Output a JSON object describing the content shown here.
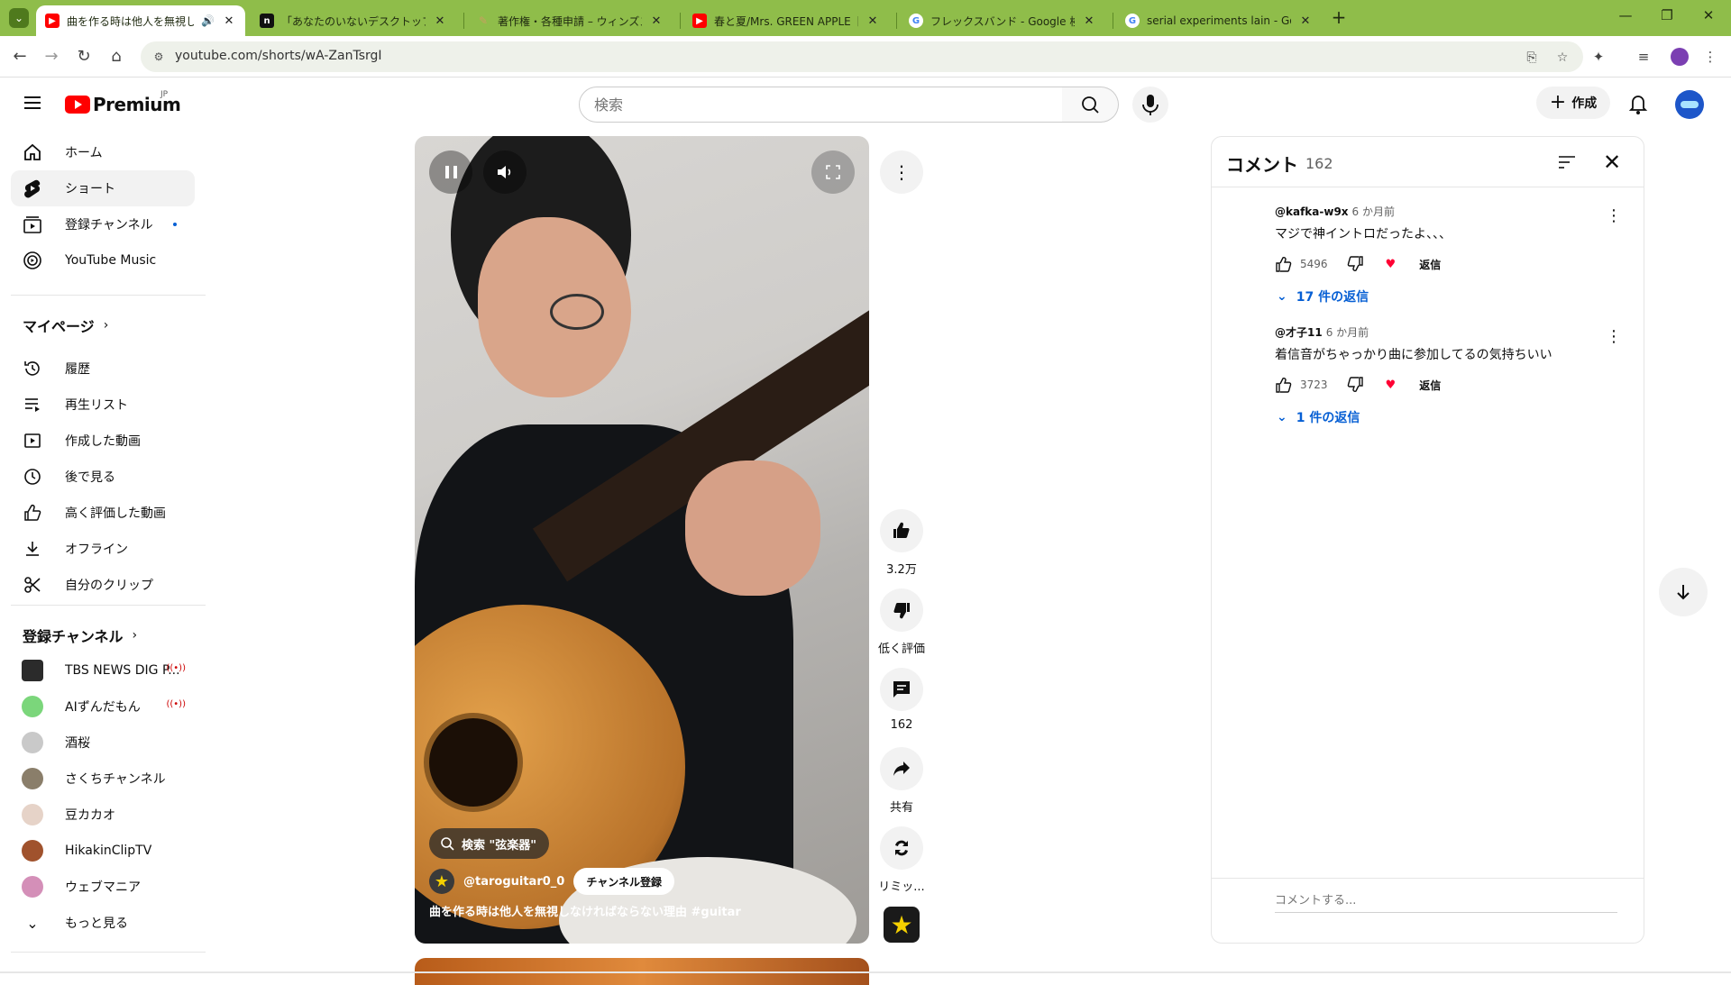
{
  "browser": {
    "tabs": [
      {
        "title": "曲を作る時は他人を無視しな",
        "favicon": "youtube-icon",
        "active": true,
        "audible": true
      },
      {
        "title": "「あなたのいないデスクトップ」につい",
        "favicon": "notion-icon",
        "active": false
      },
      {
        "title": "著作権・各種申請 – ウィンズスコア",
        "favicon": "pen-icon",
        "active": false
      },
      {
        "title": "春と夏/Mrs. GREEN APPLE【大腿",
        "favicon": "youtube-icon",
        "active": false
      },
      {
        "title": "フレックスバンド - Google 検索",
        "favicon": "google-icon",
        "active": false
      },
      {
        "title": "serial experiments lain - Google",
        "favicon": "google-icon",
        "active": false
      }
    ],
    "url": "youtube.com/shorts/wA-ZanTsrgI",
    "tabbar_color": "#8fbd4a"
  },
  "header": {
    "brand": "Premium",
    "region": "JP",
    "search_placeholder": "検索",
    "create_label": "作成"
  },
  "sidebar": {
    "main": [
      {
        "label": "ホーム",
        "icon": "home-icon"
      },
      {
        "label": "ショート",
        "icon": "shorts-icon",
        "active": true
      },
      {
        "label": "登録チャンネル",
        "icon": "subscriptions-icon",
        "new_dot": true
      },
      {
        "label": "YouTube Music",
        "icon": "youtube-music-icon"
      }
    ],
    "my_page_title": "マイページ",
    "my_page": [
      {
        "label": "履歴",
        "icon": "history-icon"
      },
      {
        "label": "再生リスト",
        "icon": "playlist-icon"
      },
      {
        "label": "作成した動画",
        "icon": "your-videos-icon"
      },
      {
        "label": "後で見る",
        "icon": "watch-later-icon"
      },
      {
        "label": "高く評価した動画",
        "icon": "liked-icon"
      },
      {
        "label": "オフライン",
        "icon": "download-icon"
      },
      {
        "label": "自分のクリップ",
        "icon": "clips-icon"
      }
    ],
    "subs_title": "登録チャンネル",
    "subscriptions": [
      {
        "label": "TBS NEWS DIG P...",
        "live": true,
        "color": "#2b2b2b"
      },
      {
        "label": "AIずんだもん",
        "live": true,
        "color": "#7bd67b"
      },
      {
        "label": "酒桜",
        "live": false,
        "color": "#c9c9c9"
      },
      {
        "label": "さくちチャンネル",
        "live": false,
        "color": "#8a7e6a"
      },
      {
        "label": "豆カカオ",
        "live": false,
        "color": "#e6d3c8"
      },
      {
        "label": "HikakinClipTV",
        "live": false,
        "color": "#a0522d"
      },
      {
        "label": "ウェブマニア",
        "live": false,
        "color": "#d48fb8"
      }
    ],
    "show_more": "もっと見る"
  },
  "video": {
    "search_chip": "検索 \"弦楽器\"",
    "channel": "@taroguitar0_0",
    "subscribe": "チャンネル登録",
    "caption": "曲を作る時は他人を無視しなければならない理由 #guitar"
  },
  "actions": {
    "likes": "3.2万",
    "dislike": "低く評価",
    "comments": "162",
    "share": "共有",
    "remix": "リミッ..."
  },
  "comments": {
    "title": "コメント",
    "count": "162",
    "items": [
      {
        "author": "@kafka-w9x",
        "time": "6 か月前",
        "text": "マジで神イントロだったよ、、、",
        "likes": "5496",
        "reply": "返信",
        "replies": "17 件の返信"
      },
      {
        "author": "@才子11",
        "time": "6 か月前",
        "text": "着信音がちゃっかり曲に参加してるの気持ちいい",
        "likes": "3723",
        "reply": "返信",
        "replies": "1 件の返信"
      }
    ],
    "input_placeholder": "コメントする..."
  }
}
